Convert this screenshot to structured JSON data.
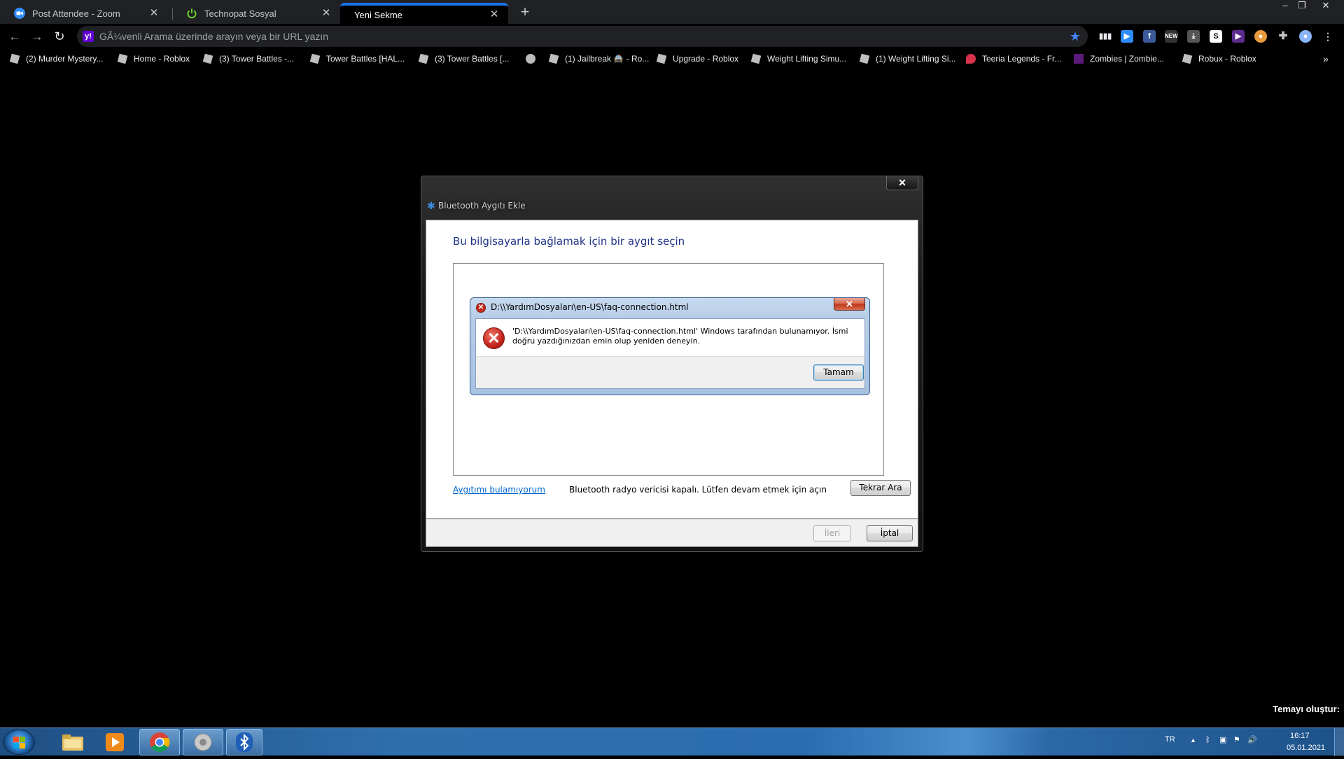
{
  "tabs": [
    {
      "title": "Post Attendee - Zoom",
      "icon": "zoom-icon"
    },
    {
      "title": "Technopat Sosyal",
      "icon": "power-icon"
    },
    {
      "title": "Yeni Sekme",
      "icon": "none",
      "active": true
    }
  ],
  "toolbar": {
    "omnibox_text": "GÃ¼venli Arama üzerinde arayın veya bir URL yazın",
    "search_engine_letter": "y!"
  },
  "bookmarks": [
    {
      "label": "(2) Murder Mystery..."
    },
    {
      "label": "Home - Roblox"
    },
    {
      "label": "(3) Tower Battles -..."
    },
    {
      "label": "Tower Battles [HAL..."
    },
    {
      "label": "(3) Tower Battles [..."
    },
    {
      "label": ""
    },
    {
      "label": "(1) Jailbreak 🚔 - Ro..."
    },
    {
      "label": "Upgrade - Roblox"
    },
    {
      "label": "Weight Lifting Simu..."
    },
    {
      "label": "(1) Weight Lifting Si..."
    },
    {
      "label": "Teeria Legends - Fr..."
    },
    {
      "label": "Zombies | Zombie..."
    },
    {
      "label": "Robux - Roblox"
    }
  ],
  "bluetooth_dialog": {
    "title": "Bluetooth Aygıtı Ekle",
    "heading": "Bu bilgisayarla bağlamak için bir aygıt seçin",
    "cant_find_link": "Aygıtımı bulamıyorum",
    "status_text": "Bluetooth radyo vericisi kapalı. Lütfen devam etmek için açın",
    "search_again_button": "Tekrar Ara",
    "next_button": "İleri",
    "cancel_button": "İptal"
  },
  "error_dialog": {
    "title": "D:\\\\YardımDosyaları\\en-US\\faq-connection.html",
    "message": "'D:\\\\YardımDosyaları\\en-US\\faq-connection.html' Windows tarafından bulunamıyor. İsmi doğru yazdığınızdan emin olup yeniden deneyin.",
    "ok_button": "Tamam"
  },
  "desktop": {
    "theme_text": "Temayı oluştur:"
  },
  "taskbar": {
    "language": "TR",
    "time": "16:17",
    "date": "05.01.2021"
  },
  "colors": {
    "chrome_accent": "#1a73e8",
    "win7_heading_blue": "#1e3287",
    "error_red": "#c42b1c"
  }
}
